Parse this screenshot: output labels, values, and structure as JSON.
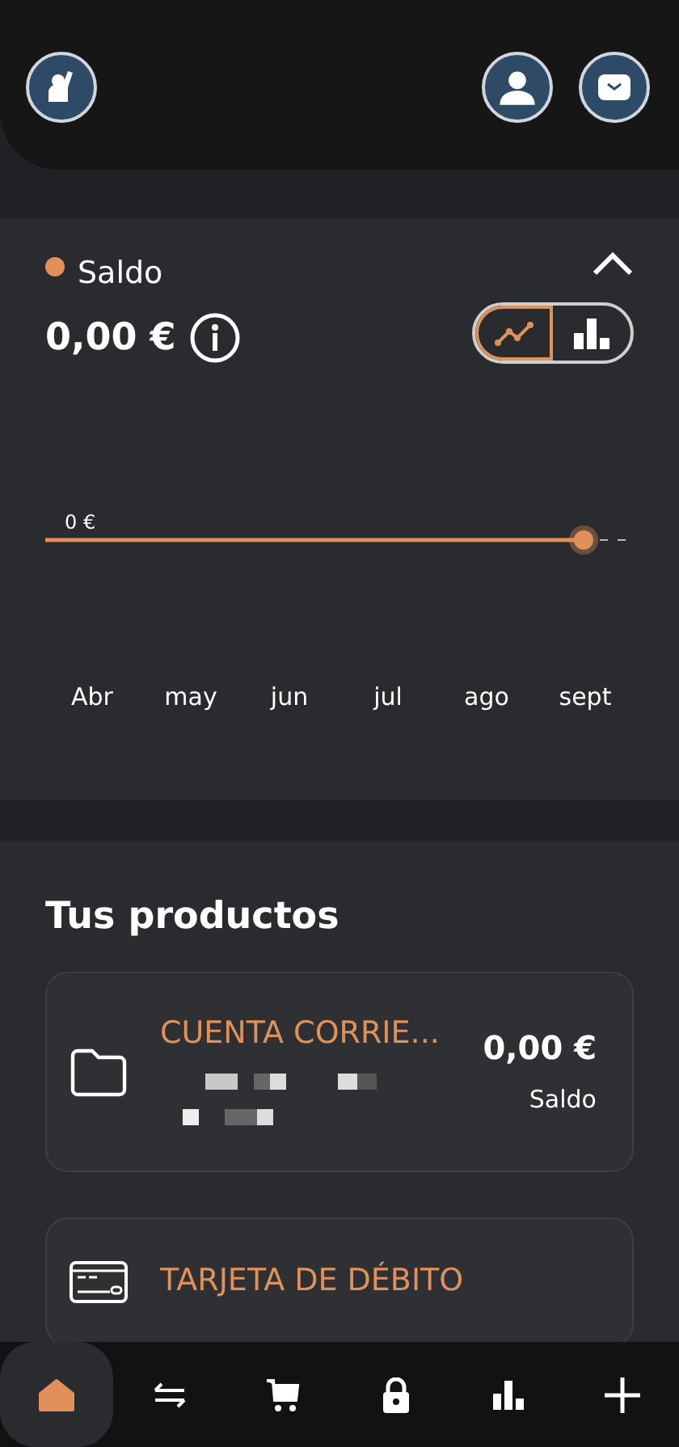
{
  "balance_card": {
    "expanded": true,
    "legend": {
      "label": "Saldo",
      "color": "#e0915a"
    },
    "amount": "0,00 €",
    "chart_toggle": [
      {
        "selected": true
      },
      {
        "selected": false
      }
    ],
    "chart": {
      "y_label": "0 €",
      "x_labels": [
        "Abr",
        "may",
        "jun",
        "jul",
        "ago",
        "sept"
      ]
    }
  },
  "products": {
    "title": "Tus productos",
    "items": [
      {
        "kind": "account",
        "name": "CUENTA CORRIE...",
        "amount": "0,00 €",
        "amount_label": "Saldo"
      },
      {
        "kind": "card",
        "name": "TARJETA DE DÉBITO"
      }
    ]
  },
  "nav": [
    {
      "selected": true
    },
    {
      "selected": false
    },
    {
      "selected": false
    },
    {
      "selected": false
    },
    {
      "selected": false
    },
    {
      "selected": false
    }
  ]
}
